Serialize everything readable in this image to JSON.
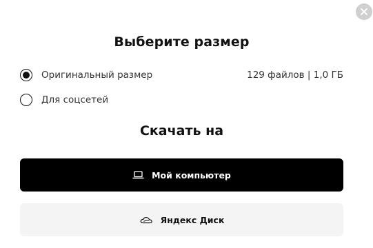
{
  "dialog": {
    "title": "Выберите размер",
    "options": [
      {
        "label": "Оригинальный размер",
        "info": "129 файлов | 1,0 ГБ",
        "selected": true
      },
      {
        "label": "Для соцсетей",
        "selected": false
      }
    ],
    "download_title": "Скачать на",
    "buttons": {
      "computer": {
        "label": "Мой компьютер",
        "icon": "laptop-icon"
      },
      "yandex_disk": {
        "label": "Яндекс Диск",
        "icon": "cloud-icon"
      }
    },
    "close_icon": "close-icon"
  },
  "colors": {
    "primary_button_bg": "#000000",
    "secondary_button_bg": "#f4f4f4",
    "close_button_bg": "#cfcfcf"
  }
}
